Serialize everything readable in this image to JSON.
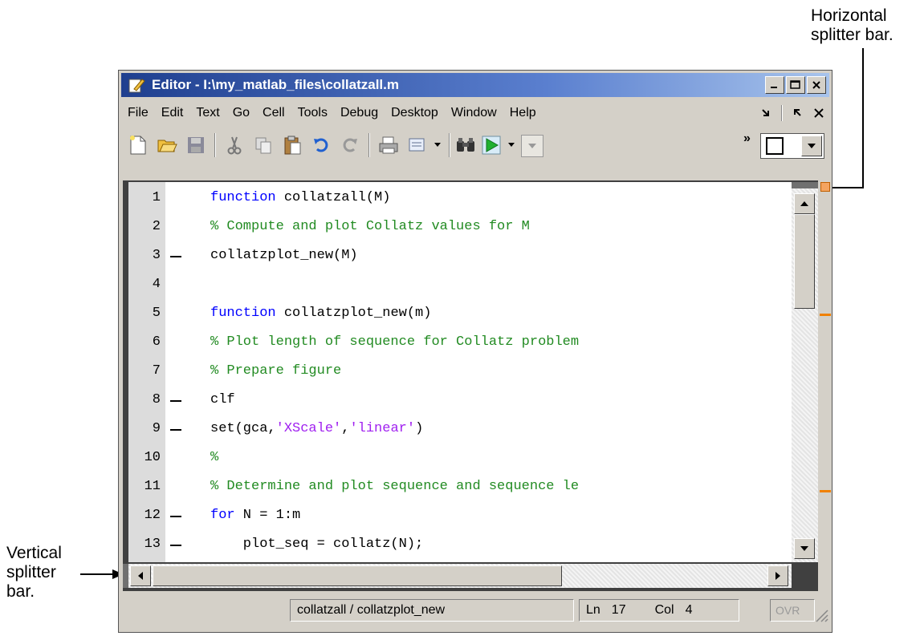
{
  "annotations": {
    "horizontal_line1": "Horizontal",
    "horizontal_line2": "splitter bar.",
    "vertical_line1": "Vertical",
    "vertical_line2": "splitter",
    "vertical_line3": "bar."
  },
  "window": {
    "title": "Editor - I:\\my_matlab_files\\collatzall.m"
  },
  "menu": {
    "items": [
      "File",
      "Edit",
      "Text",
      "Go",
      "Cell",
      "Tools",
      "Debug",
      "Desktop",
      "Window",
      "Help"
    ]
  },
  "editor": {
    "lines": [
      {
        "num": "1",
        "dash": false,
        "parts": [
          {
            "t": "kw",
            "s": "function"
          },
          {
            "t": "plain",
            "s": " collatzall(M)"
          }
        ]
      },
      {
        "num": "2",
        "dash": false,
        "parts": [
          {
            "t": "cm",
            "s": "% Compute and plot Collatz values for M"
          }
        ]
      },
      {
        "num": "3",
        "dash": true,
        "parts": [
          {
            "t": "plain",
            "s": "collatzplot_new(M)"
          }
        ]
      },
      {
        "num": "4",
        "dash": false,
        "parts": []
      },
      {
        "num": "5",
        "dash": false,
        "parts": [
          {
            "t": "kw",
            "s": "function"
          },
          {
            "t": "plain",
            "s": " collatzplot_new(m)"
          }
        ]
      },
      {
        "num": "6",
        "dash": false,
        "parts": [
          {
            "t": "cm",
            "s": "% Plot length of sequence for Collatz problem"
          }
        ]
      },
      {
        "num": "7",
        "dash": false,
        "parts": [
          {
            "t": "cm",
            "s": "% Prepare figure"
          }
        ]
      },
      {
        "num": "8",
        "dash": true,
        "parts": [
          {
            "t": "plain",
            "s": "clf"
          }
        ]
      },
      {
        "num": "9",
        "dash": true,
        "parts": [
          {
            "t": "plain",
            "s": "set(gca,"
          },
          {
            "t": "str",
            "s": "'XScale'"
          },
          {
            "t": "plain",
            "s": ","
          },
          {
            "t": "str",
            "s": "'linear'"
          },
          {
            "t": "plain",
            "s": ")"
          }
        ]
      },
      {
        "num": "10",
        "dash": false,
        "parts": [
          {
            "t": "cm",
            "s": "%"
          }
        ]
      },
      {
        "num": "11",
        "dash": false,
        "parts": [
          {
            "t": "cm",
            "s": "% Determine and plot sequence and sequence le"
          }
        ]
      },
      {
        "num": "12",
        "dash": true,
        "parts": [
          {
            "t": "kw",
            "s": "for"
          },
          {
            "t": "plain",
            "s": " N = 1:m"
          }
        ]
      },
      {
        "num": "13",
        "dash": true,
        "parts": [
          {
            "t": "plain",
            "s": "    plot_seq = collatz(N);"
          }
        ]
      }
    ]
  },
  "statusbar": {
    "function_path": "collatzall / collatzplot_new",
    "ln_label": "Ln",
    "ln_value": "17",
    "col_label": "Col",
    "col_value": "4",
    "ovr": "OVR"
  }
}
